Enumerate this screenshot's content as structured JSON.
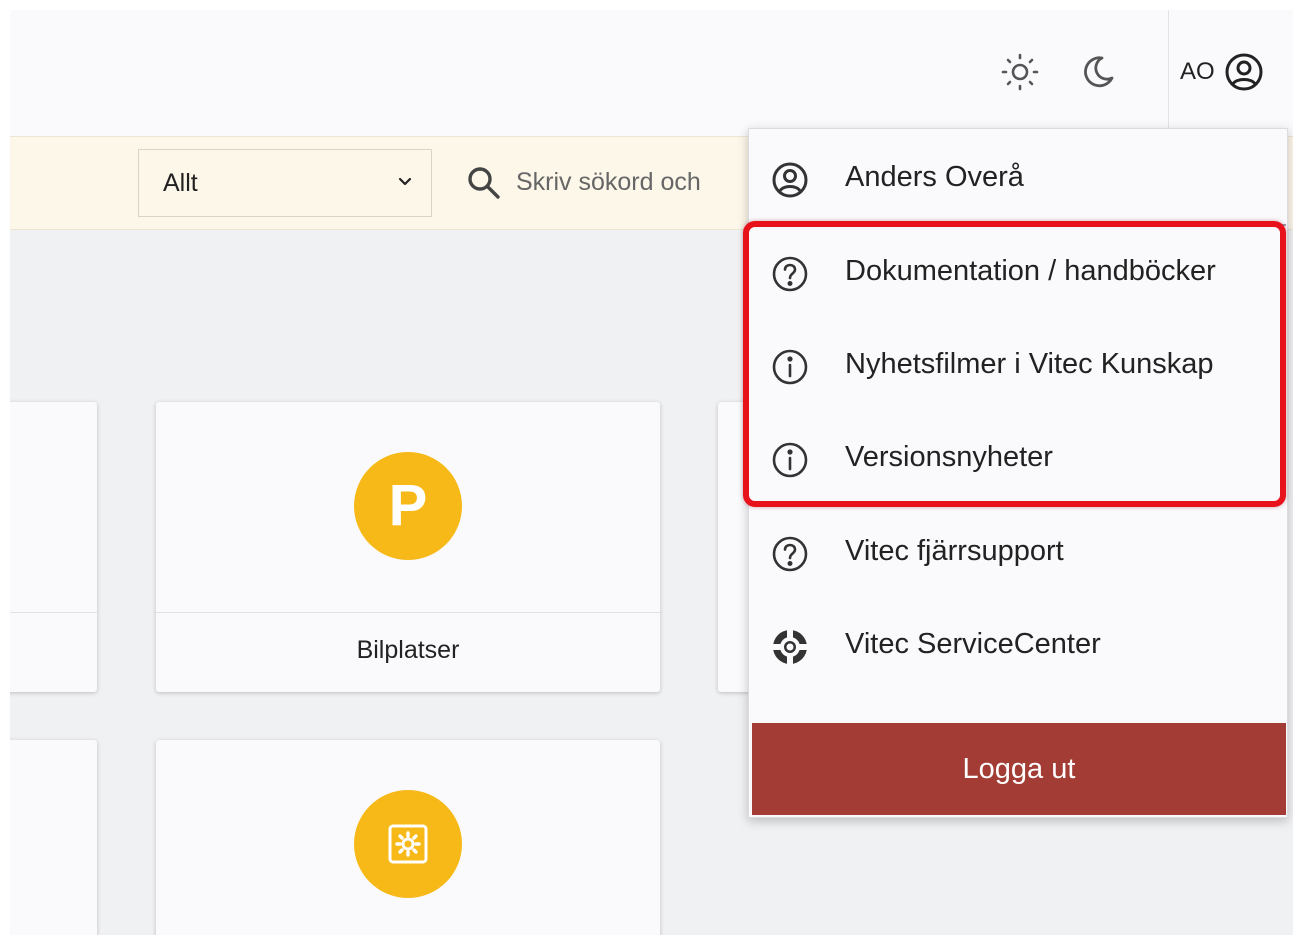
{
  "header": {
    "user_initials": "AO",
    "icons": {
      "light_mode": "sun-icon",
      "dark_mode": "moon-icon",
      "user": "user-circle-icon"
    }
  },
  "search": {
    "category_selected": "Allt",
    "placeholder": "Skriv sökord och"
  },
  "cards": [
    {
      "title": "Bilplatser",
      "icon_letter": "P",
      "icon_color": "#f7b917"
    },
    {
      "title": "",
      "icon": "gear-box-icon",
      "icon_color": "#f7b917"
    }
  ],
  "user_menu": {
    "user_name": "Anders Overå",
    "items": [
      {
        "label": "Dokumentation / handböcker",
        "icon": "help-circle-icon"
      },
      {
        "label": "Nyhetsfilmer i Vitec Kunskap",
        "icon": "info-circle-icon"
      },
      {
        "label": "Versionsnyheter",
        "icon": "info-circle-icon"
      },
      {
        "label": "Vitec fjärrsupport",
        "icon": "help-circle-icon"
      },
      {
        "label": "Vitec ServiceCenter",
        "icon": "lifebuoy-icon"
      }
    ],
    "logout_label": "Logga ut",
    "logout_color": "#a23c35"
  },
  "annotation": {
    "color": "#e8121b"
  }
}
